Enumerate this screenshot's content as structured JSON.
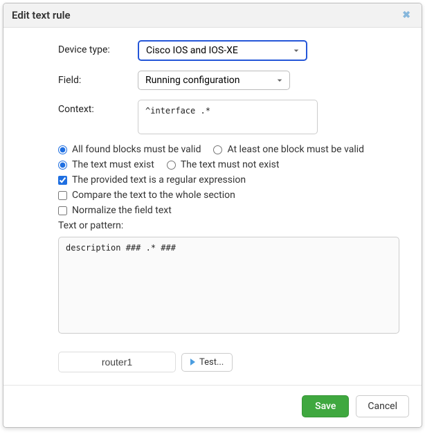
{
  "dialog": {
    "title": "Edit text rule"
  },
  "labels": {
    "device_type": "Device type:",
    "field": "Field:",
    "context": "Context:",
    "text_or_pattern": "Text or pattern:"
  },
  "fields": {
    "device_type_value": "Cisco IOS and IOS-XE",
    "field_value": "Running configuration",
    "context_value": "^interface .*",
    "pattern_value": "description ### .* ###",
    "test_device_value": "router1"
  },
  "options": {
    "all_blocks_valid": "All found blocks must be valid",
    "at_least_one_valid": "At least one block must be valid",
    "must_exist": "The text must exist",
    "must_not_exist": "The text must not exist",
    "is_regex": "The provided text is a regular expression",
    "compare_whole": "Compare the text to the whole section",
    "normalize": "Normalize the field text"
  },
  "buttons": {
    "test": "Test...",
    "save": "Save",
    "cancel": "Cancel"
  }
}
